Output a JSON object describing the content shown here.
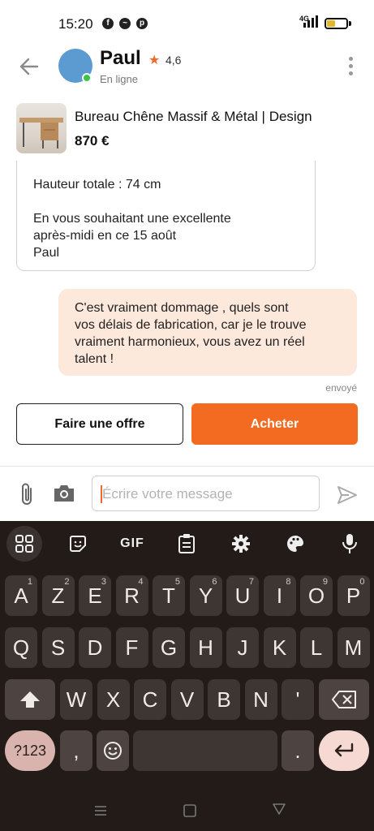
{
  "status_bar": {
    "time": "15:20",
    "app_icons": [
      "facebook-icon",
      "messenger-icon",
      "pinterest-icon"
    ],
    "network": "4G",
    "battery_level": 0.45
  },
  "header": {
    "name": "Paul",
    "rating": "4,6",
    "status": "En ligne",
    "avatar_color": "#5b9bd1",
    "online_color": "#38c545"
  },
  "product": {
    "title": "Bureau Chêne Massif & Métal | Design",
    "price": "870 €"
  },
  "messages": {
    "received": {
      "lines": [
        "Hauteur totale : 74 cm",
        "En vous souhaitant une excellente",
        "après-midi en ce 15 août",
        "Paul"
      ]
    },
    "sent": {
      "lines": [
        "C'est vraiment dommage , quels sont",
        "vos délais de fabrication, car je le trouve",
        "vraiment harmonieux, vous avez un réel",
        "talent !"
      ],
      "status": "envoyé"
    }
  },
  "actions": {
    "offer_label": "Faire une offre",
    "buy_label": "Acheter"
  },
  "composer": {
    "placeholder": "Écrire votre message",
    "value": ""
  },
  "keyboard": {
    "toolbar": [
      "apps-grid-icon",
      "sticker-icon",
      "GIF",
      "clipboard-icon",
      "gear-icon",
      "palette-icon",
      "mic-icon"
    ],
    "gif_label": "GIF",
    "row1": [
      {
        "k": "A",
        "h": "1"
      },
      {
        "k": "Z",
        "h": "2"
      },
      {
        "k": "E",
        "h": "3"
      },
      {
        "k": "R",
        "h": "4"
      },
      {
        "k": "T",
        "h": "5"
      },
      {
        "k": "Y",
        "h": "6"
      },
      {
        "k": "U",
        "h": "7"
      },
      {
        "k": "I",
        "h": "8"
      },
      {
        "k": "O",
        "h": "9"
      },
      {
        "k": "P",
        "h": "0"
      }
    ],
    "row2": [
      "Q",
      "S",
      "D",
      "F",
      "G",
      "H",
      "J",
      "K",
      "L",
      "M"
    ],
    "row3": [
      "W",
      "X",
      "C",
      "V",
      "B",
      "N",
      "'"
    ],
    "sym_label": "?123",
    "comma": ",",
    "period": "."
  },
  "colors": {
    "accent": "#f26b21",
    "sent_bubble": "#fde8dc",
    "keyboard_bg": "#221b18"
  }
}
